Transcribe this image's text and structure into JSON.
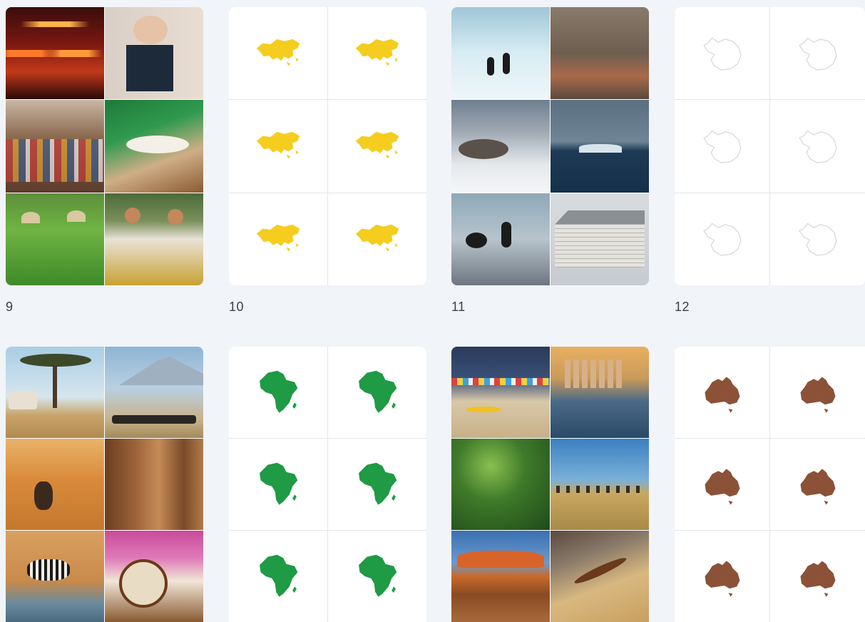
{
  "rows": [
    {
      "sheets": [
        {
          "caption": "9",
          "kind": "photo",
          "theme": "asia",
          "tiles": [
            "night-market-lanterns",
            "portrait-woman",
            "crowded-market-street",
            "sushi-dinner",
            "rice-field-farmers",
            "traditional-dancers"
          ]
        },
        {
          "caption": "10",
          "kind": "map",
          "continent": "asia",
          "color": "#f5cd1f"
        },
        {
          "caption": "11",
          "kind": "photo",
          "theme": "antarctica",
          "tiles": [
            "penguins-on-ice",
            "research-station-hill",
            "seals-on-snow",
            "iceberg-sea",
            "penguins-on-shore",
            "wooden-hut"
          ]
        },
        {
          "caption": "12",
          "kind": "map",
          "continent": "antarctica",
          "color": "#cfd3d9"
        }
      ]
    },
    {
      "sheets": [
        {
          "caption": "",
          "kind": "photo",
          "theme": "africa",
          "tiles": [
            "acacia-safari",
            "kilimanjaro-elephants",
            "desert-camels",
            "carved-masks",
            "zebras-waterhole",
            "drummers"
          ]
        },
        {
          "caption": "",
          "kind": "map",
          "continent": "africa",
          "color": "#1f9a45"
        },
        {
          "caption": "",
          "kind": "photo",
          "theme": "australia",
          "tiles": [
            "beach-huts-surfer",
            "city-skyline-river",
            "rainforest",
            "grassland-emus",
            "uluru",
            "boomerang-hat"
          ]
        },
        {
          "caption": "",
          "kind": "map",
          "continent": "australia",
          "color": "#8b5238"
        }
      ]
    }
  ]
}
